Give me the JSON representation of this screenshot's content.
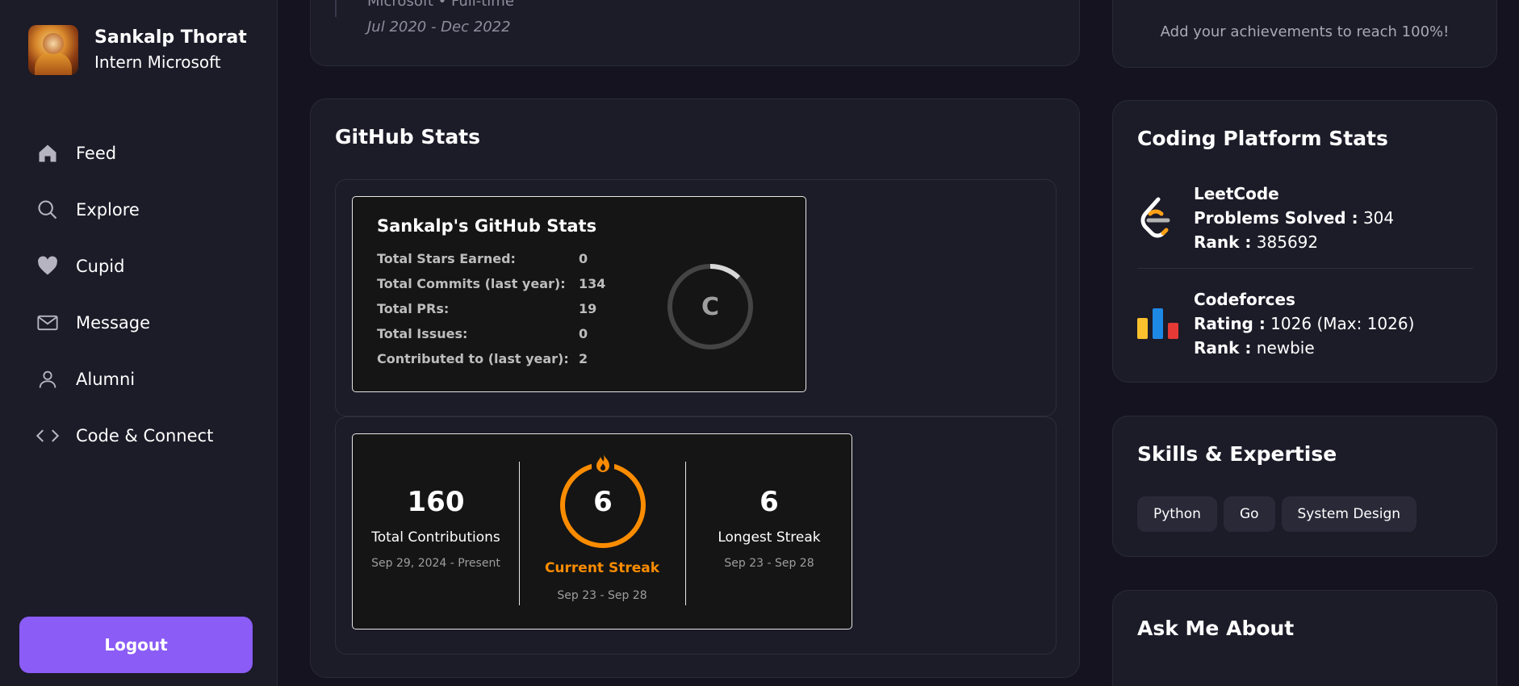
{
  "profile": {
    "name": "Sankalp Thorat",
    "role": "Intern Microsoft"
  },
  "nav": [
    {
      "label": "Feed",
      "icon": "home-icon"
    },
    {
      "label": "Explore",
      "icon": "search-icon"
    },
    {
      "label": "Cupid",
      "icon": "heart-icon"
    },
    {
      "label": "Message",
      "icon": "mail-icon"
    },
    {
      "label": "Alumni",
      "icon": "user-icon"
    },
    {
      "label": "Code & Connect",
      "icon": "code-icon"
    }
  ],
  "logout_label": "Logout",
  "experience": {
    "company_line": "Microsoft • Full-time",
    "dates": "Jul 2020 - Dec 2022"
  },
  "achievements_hint": "Add your achievements to reach 100%!",
  "github": {
    "section_title": "GitHub Stats",
    "card_title": "Sankalp's GitHub Stats",
    "rows": [
      {
        "label": "Total Stars Earned:",
        "value": "0"
      },
      {
        "label": "Total Commits (last year):",
        "value": "134"
      },
      {
        "label": "Total PRs:",
        "value": "19"
      },
      {
        "label": "Total Issues:",
        "value": "0"
      },
      {
        "label": "Contributed to (last year):",
        "value": "2"
      }
    ],
    "grade": "C",
    "streak": {
      "total": {
        "value": "160",
        "label": "Total Contributions",
        "dates": "Sep 29, 2024 - Present"
      },
      "current": {
        "value": "6",
        "label": "Current Streak",
        "dates": "Sep 23 - Sep 28"
      },
      "longest": {
        "value": "6",
        "label": "Longest Streak",
        "dates": "Sep 23 - Sep 28"
      }
    }
  },
  "coding": {
    "title": "Coding Platform Stats",
    "leetcode": {
      "name": "LeetCode",
      "l1_label": "Problems Solved :",
      "l1_value": " 304",
      "l2_label": "Rank :",
      "l2_value": " 385692"
    },
    "codeforces": {
      "name": "Codeforces",
      "l1_label": "Rating :",
      "l1_value": " 1026 (Max: 1026)",
      "l2_label": "Rank :",
      "l2_value": " newbie"
    }
  },
  "skills": {
    "title": "Skills & Expertise",
    "items": [
      "Python",
      "Go",
      "System Design"
    ]
  },
  "ask": {
    "title": "Ask Me About"
  },
  "colors": {
    "accent": "#8b5cf6",
    "streak_orange": "#fb8c00",
    "card_bg": "#1c1b28",
    "page_bg": "#14131f"
  }
}
